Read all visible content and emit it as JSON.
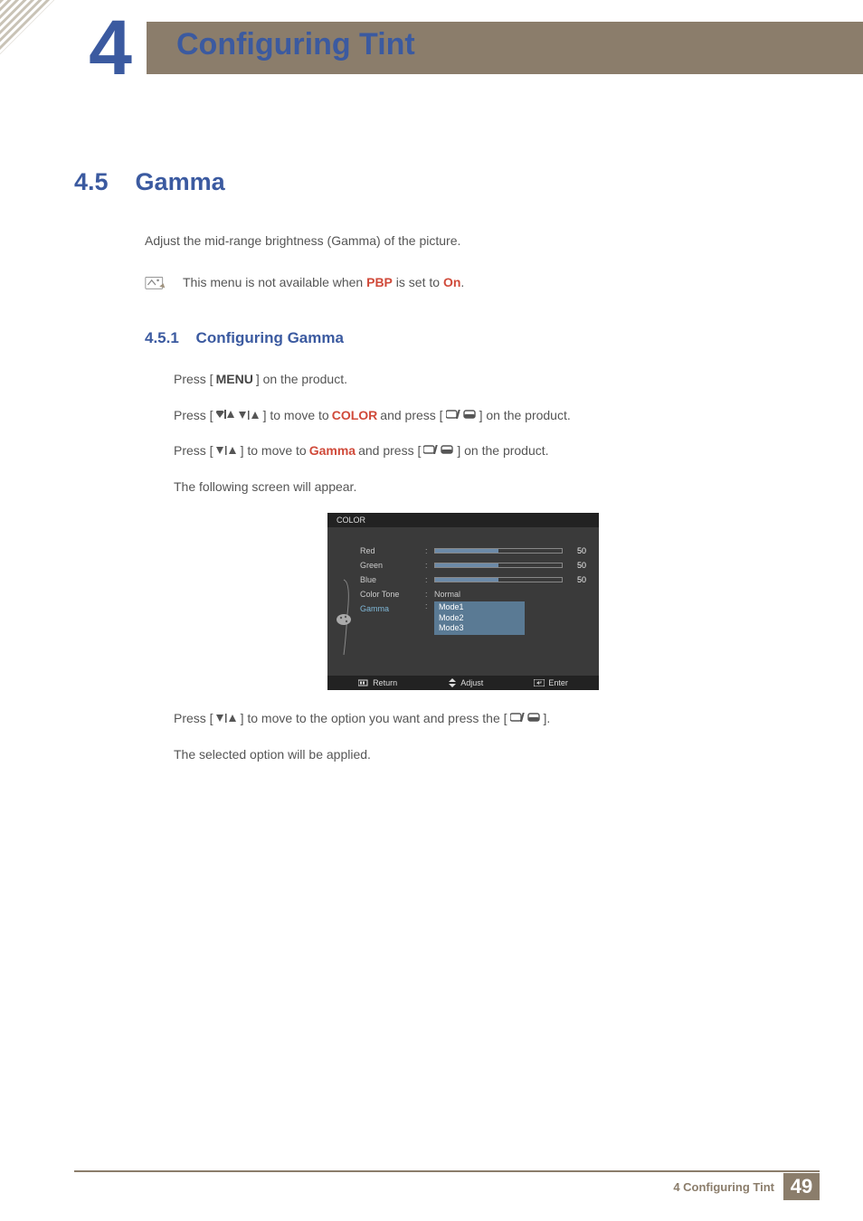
{
  "header": {
    "chapter_num": "4",
    "title": "Configuring Tint"
  },
  "section": {
    "number": "4.5",
    "title": "Gamma",
    "intro": "Adjust the mid-range brightness (Gamma) of the picture.",
    "note_prefix": "This menu is not available when ",
    "note_pbp": "PBP",
    "note_mid": " is set to ",
    "note_on": "On",
    "note_suffix": "."
  },
  "subsection": {
    "number": "4.5.1",
    "title": "Configuring Gamma"
  },
  "steps": {
    "s1a": "Press [",
    "s1_menu": "MENU",
    "s1b": "] on the product.",
    "s2a": "Press [",
    "s2b": "] to move to ",
    "s2_color": "COLOR",
    "s2c": " and press [",
    "s2d": "] on the product.",
    "s3a": "Press [",
    "s3b": "] to move to ",
    "s3_gamma": "Gamma",
    "s3c": " and press [",
    "s3d": "] on the product.",
    "s4": "The following screen will appear.",
    "s5a": "Press [",
    "s5b": "] to move to the option you want and press the [",
    "s5c": "].",
    "s6": "The selected option will be applied."
  },
  "osd": {
    "title": "COLOR",
    "labels": {
      "red": "Red",
      "green": "Green",
      "blue": "Blue",
      "color_tone": "Color Tone",
      "gamma": "Gamma"
    },
    "values": {
      "red": "50",
      "green": "50",
      "blue": "50",
      "color_tone": "Normal",
      "modes": [
        "Mode1",
        "Mode2",
        "Mode3"
      ]
    },
    "foot": {
      "return": "Return",
      "adjust": "Adjust",
      "enter": "Enter"
    }
  },
  "footer": {
    "text": "4 Configuring Tint",
    "page": "49"
  },
  "chart_data": {
    "type": "bar",
    "title": "COLOR OSD sliders",
    "categories": [
      "Red",
      "Green",
      "Blue"
    ],
    "values": [
      50,
      50,
      50
    ],
    "ylim": [
      0,
      100
    ]
  }
}
